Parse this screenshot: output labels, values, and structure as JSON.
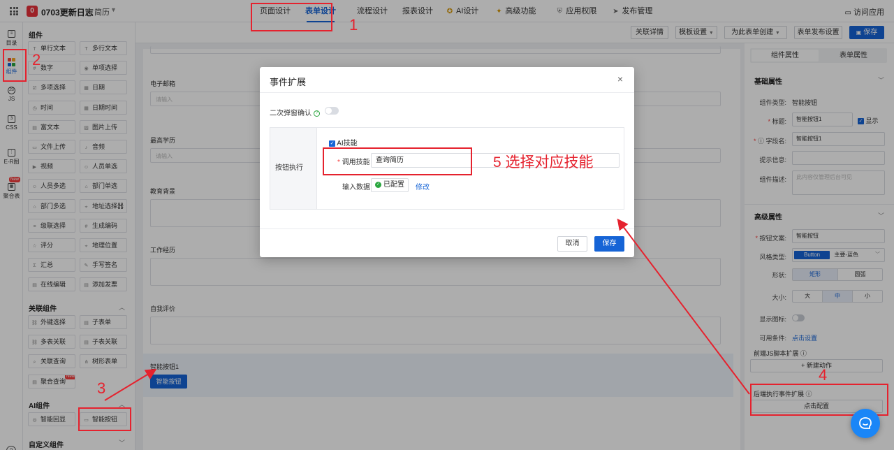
{
  "header": {
    "app_badge": "0",
    "app_title": "0703更新日志",
    "crumb_sep": ">",
    "form_name": "简历",
    "tabs": [
      {
        "label": "页面设计",
        "icon": ""
      },
      {
        "label": "表单设计",
        "icon": "",
        "active": true
      },
      {
        "label": "流程设计",
        "icon": ""
      },
      {
        "label": "报表设计",
        "icon": ""
      },
      {
        "label": "AI设计",
        "icon": "ai-icon"
      },
      {
        "label": "高级功能",
        "icon": "magic-wand-icon"
      },
      {
        "label": "应用权限",
        "icon": "shield-icon"
      },
      {
        "label": "发布管理",
        "icon": "send-icon"
      }
    ],
    "visit_app": "访问应用"
  },
  "rail": {
    "items": [
      {
        "label": "目录",
        "icon": "catalog-icon"
      },
      {
        "label": "组件",
        "icon": "blocks-icon",
        "active": true
      },
      {
        "label": "JS",
        "icon": "js-icon"
      },
      {
        "label": "CSS",
        "icon": "css-icon"
      },
      {
        "label": "E-R图",
        "icon": "er-diagram-icon"
      },
      {
        "label": "聚合表",
        "icon": "aggregate-table-icon",
        "badge": "New"
      }
    ],
    "help": "?"
  },
  "components": {
    "title": "组件",
    "basic": [
      {
        "label": "单行文本",
        "icon": "T"
      },
      {
        "label": "多行文本",
        "icon": "T"
      },
      {
        "label": "数字",
        "icon": "#"
      },
      {
        "label": "单项选择",
        "icon": "◉"
      },
      {
        "label": "多项选择",
        "icon": "☑"
      },
      {
        "label": "日期",
        "icon": "▦"
      },
      {
        "label": "时间",
        "icon": "◷"
      },
      {
        "label": "日期时间",
        "icon": "▦"
      },
      {
        "label": "富文本",
        "icon": "▤"
      },
      {
        "label": "图片上传",
        "icon": "▨"
      },
      {
        "label": "文件上传",
        "icon": "▭"
      },
      {
        "label": "音频",
        "icon": "♪"
      },
      {
        "label": "视频",
        "icon": "▶"
      },
      {
        "label": "人员单选",
        "icon": "☺"
      },
      {
        "label": "人员多选",
        "icon": "☺"
      },
      {
        "label": "部门单选",
        "icon": "⌂"
      },
      {
        "label": "部门多选",
        "icon": "⌂"
      },
      {
        "label": "地址选择器",
        "icon": "⌖"
      },
      {
        "label": "级联选择",
        "icon": "≡"
      },
      {
        "label": "生成编码",
        "icon": "#"
      },
      {
        "label": "评分",
        "icon": "☆"
      },
      {
        "label": "地理位置",
        "icon": "⌖"
      },
      {
        "label": "汇总",
        "icon": "Σ"
      },
      {
        "label": "手写签名",
        "icon": "✎"
      },
      {
        "label": "在线编辑",
        "icon": "▤"
      },
      {
        "label": "添加发票",
        "icon": "▤"
      }
    ],
    "related_title": "关联组件",
    "related": [
      {
        "label": "外键选择",
        "icon": "⛓"
      },
      {
        "label": "子表单",
        "icon": "▤"
      },
      {
        "label": "多表关联",
        "icon": "⛓"
      },
      {
        "label": "子表关联",
        "icon": "▤"
      },
      {
        "label": "关联查询",
        "icon": "⌕"
      },
      {
        "label": "树形表单",
        "icon": "⋔"
      },
      {
        "label": "聚合查询",
        "icon": "▤",
        "badge": "New"
      }
    ],
    "ai_title": "AI组件",
    "ai": [
      {
        "label": "智能回显",
        "icon": "◎"
      },
      {
        "label": "智能按钮",
        "icon": "▭"
      }
    ],
    "custom_title": "自定义组件"
  },
  "toolbar": {
    "related_details": "关联详情",
    "template_settings": "模板设置",
    "create_for_form": "为此表单创建",
    "publish_settings": "表单发布设置",
    "save": "保存"
  },
  "canvas": {
    "fields": [
      {
        "label": "电子邮箱",
        "placeholder": "请输入"
      },
      {
        "label": "最高学历",
        "placeholder": "请输入"
      },
      {
        "label": "教育背景",
        "placeholder": ""
      },
      {
        "label": "工作经历",
        "placeholder": ""
      },
      {
        "label": "自我评价",
        "placeholder": ""
      }
    ],
    "smart_label": "智能按钮1",
    "smart_button": "智能按钮"
  },
  "right": {
    "tab_component": "组件属性",
    "tab_form": "表单属性",
    "basic_title": "基础属性",
    "type_label": "组件类型:",
    "type_value": "智能按钮",
    "title_label": "标题:",
    "title_value": "智能按钮1",
    "show_label": "显示",
    "field_label": "字段名:",
    "field_value": "智能按钮1",
    "hint_label": "提示信息:",
    "desc_label": "组件描述:",
    "desc_placeholder": "此内容仅管理后台可见",
    "advanced_title": "高级属性",
    "btn_text_label": "按钮文案:",
    "btn_text_value": "智能按钮",
    "style_label": "风格类型:",
    "style_chip": "Button",
    "style_value": "主要-蓝色",
    "shape_label": "形状:",
    "shape_options": [
      "矩形",
      "圆弧"
    ],
    "size_label": "大小:",
    "size_options": [
      "大",
      "中",
      "小"
    ],
    "show_icon_label": "显示图标:",
    "cond_label": "可用条件:",
    "cond_link": "点击设置",
    "front_js_label": "前端JS脚本扩展",
    "new_action": "+ 新建动作",
    "backend_label": "后端执行事件扩展",
    "click_config": "点击配置"
  },
  "modal": {
    "title": "事件扩展",
    "close": "×",
    "confirm_label": "二次弹窗确认",
    "left_label": "按钮执行",
    "ai_skill": "AI技能",
    "call_skill_label": "调用技能",
    "call_skill_value": "查询简历",
    "input_label": "输入数据",
    "configured": "已配置",
    "modify": "修改",
    "cancel": "取消",
    "save": "保存"
  },
  "annotations": {
    "n1": "1",
    "n2": "2",
    "n3": "3",
    "n4": "4",
    "n5": "5 选择对应技能"
  },
  "colors": {
    "primary": "#1664d6",
    "annotation_red": "#e5222e",
    "brand_red": "#e8313a",
    "success": "#2aa63e"
  }
}
